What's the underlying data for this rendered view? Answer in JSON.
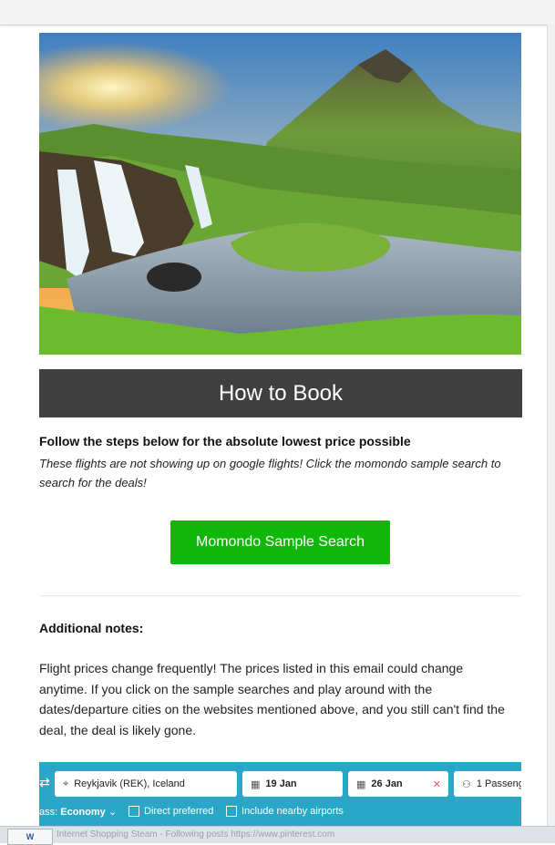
{
  "hero": {
    "image": "iceland-waterfall-mountain-photo"
  },
  "how_to_book": "How to Book",
  "lead": "Follow the steps below for the absolute lowest price possible",
  "note": "These flights are not showing up on google flights! Click the momondo sample search to search for the deals!",
  "cta": {
    "label": "Momondo Sample Search"
  },
  "additional": {
    "title": "Additional notes:",
    "body": "Flight prices change frequently! The prices listed in this email could change anytime. If you click on the sample searches and play around with the dates/departure cities on the websites mentioned above, and you still can't find the deal, the deal is likely gone."
  },
  "search_screenshot": {
    "origin": "Reykjavik (REK), Iceland",
    "depart": "19 Jan",
    "return": "26 Jan",
    "passengers": "1 Passeng",
    "class_prefix": "ass:",
    "class_value": "Economy",
    "direct": "Direct preferred",
    "nearby": "Include nearby airports"
  },
  "taskbar": {
    "icon_label": "W",
    "text": "Internet Shopping Steam - Following posts https://www.pinterest.com"
  },
  "colors": {
    "header_bg": "#404040",
    "cta_bg": "#10b809",
    "search_bg": "#2aa7c6"
  }
}
